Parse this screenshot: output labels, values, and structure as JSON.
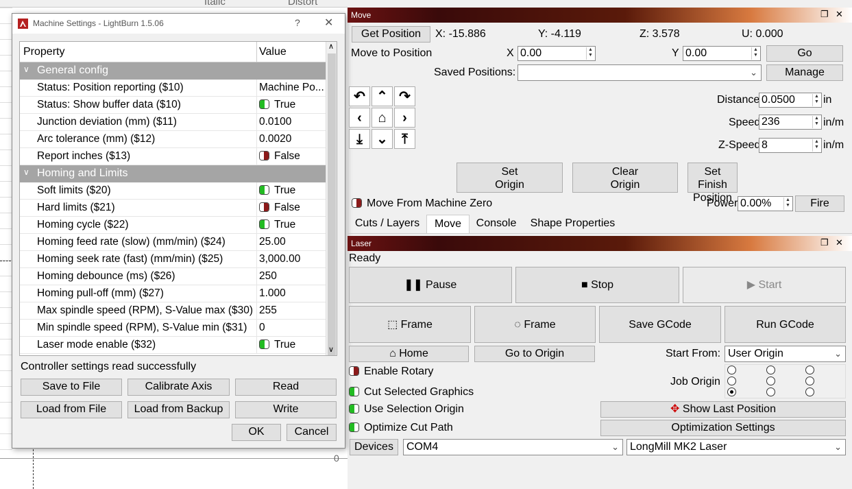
{
  "background": {
    "tabs": [
      "Italic",
      "Distort"
    ],
    "axis_zero": "0"
  },
  "dialog": {
    "title": "Machine Settings - LightBurn 1.5.06",
    "help": "?",
    "close": "✕",
    "columns": [
      "Property",
      "Value"
    ],
    "groups": [
      {
        "label": "General config",
        "rows": [
          {
            "key": "Status: Position reporting ($10)",
            "value": "Machine Po...",
            "toggle": null
          },
          {
            "key": "Status: Show buffer data ($10)",
            "value": "True",
            "toggle": "on"
          },
          {
            "key": "Junction deviation (mm) ($11)",
            "value": "0.0100",
            "toggle": null
          },
          {
            "key": "Arc tolerance (mm) ($12)",
            "value": "0.0020",
            "toggle": null
          },
          {
            "key": "Report inches ($13)",
            "value": "False",
            "toggle": "off"
          }
        ]
      },
      {
        "label": "Homing and Limits",
        "rows": [
          {
            "key": "Soft limits ($20)",
            "value": "True",
            "toggle": "on"
          },
          {
            "key": "Hard limits ($21)",
            "value": "False",
            "toggle": "off"
          },
          {
            "key": "Homing cycle ($22)",
            "value": "True",
            "toggle": "on"
          },
          {
            "key": "Homing feed rate (slow) (mm/min) ($24)",
            "value": "25.00",
            "toggle": null
          },
          {
            "key": "Homing seek rate (fast) (mm/min) ($25)",
            "value": "3,000.00",
            "toggle": null
          },
          {
            "key": "Homing debounce (ms) ($26)",
            "value": "250",
            "toggle": null
          },
          {
            "key": "Homing pull-off (mm) ($27)",
            "value": "1.000",
            "toggle": null
          },
          {
            "key": "Max spindle speed (RPM), S-Value max ($30)",
            "value": "255",
            "toggle": null
          },
          {
            "key": "Min spindle speed (RPM), S-Value min ($31)",
            "value": "0",
            "toggle": null
          },
          {
            "key": "Laser mode enable ($32)",
            "value": "True",
            "toggle": "on"
          }
        ]
      }
    ],
    "status": "Controller settings read successfully",
    "buttons": {
      "save_to_file": "Save to File",
      "calibrate_axis": "Calibrate Axis",
      "read": "Read",
      "load_from_file": "Load from File",
      "load_from_backup": "Load from Backup",
      "write": "Write",
      "ok": "OK",
      "cancel": "Cancel"
    }
  },
  "move": {
    "title": "Move",
    "get_position": "Get Position",
    "x": "X: -15.886",
    "y": "Y: -4.119",
    "z": "Z: 3.578",
    "u": "U: 0.000",
    "move_to_position": "Move to Position",
    "x_label": "X",
    "x_value": "0.00",
    "y_label": "Y",
    "y_value": "0.00",
    "go": "Go",
    "saved_positions": "Saved Positions:",
    "saved_value": "",
    "manage": "Manage",
    "distance_label": "Distance",
    "distance_value": "0.0500",
    "distance_unit": "in",
    "speed_label": "Speed",
    "speed_value": "236",
    "speed_unit": "in/m",
    "zspeed_label": "Z-Speed",
    "zspeed_value": "8",
    "zspeed_unit": "in/m",
    "set_origin": "Set\nOrigin",
    "clear_origin": "Clear\nOrigin",
    "set_finish": "Set Finish\nPosition",
    "move_from_zero": "Move From Machine Zero",
    "power_label": "Power",
    "power_value": "0.00%",
    "fire": "Fire"
  },
  "tabs": [
    "Cuts / Layers",
    "Move",
    "Console",
    "Shape Properties"
  ],
  "laser": {
    "title": "Laser",
    "status": "Ready",
    "pause": "Pause",
    "stop": "Stop",
    "start": "Start",
    "frame1": "Frame",
    "frame2": "Frame",
    "save_gcode": "Save GCode",
    "run_gcode": "Run GCode",
    "home": "Home",
    "go_to_origin": "Go to Origin",
    "start_from_label": "Start From:",
    "start_from_value": "User Origin",
    "enable_rotary": "Enable Rotary",
    "cut_selected": "Cut Selected Graphics",
    "use_selection_origin": "Use Selection Origin",
    "optimize_cut_path": "Optimize Cut Path",
    "job_origin": "Job Origin",
    "show_last_position": "Show Last Position",
    "optimization_settings": "Optimization Settings",
    "devices": "Devices",
    "port": "COM4",
    "device": "LongMill MK2 Laser"
  },
  "colors": {
    "toggle_on": "#22bb22",
    "toggle_off": "#8b1a1a",
    "group_header": "#a5a5a5",
    "title_bar": "#5a1a0a"
  }
}
